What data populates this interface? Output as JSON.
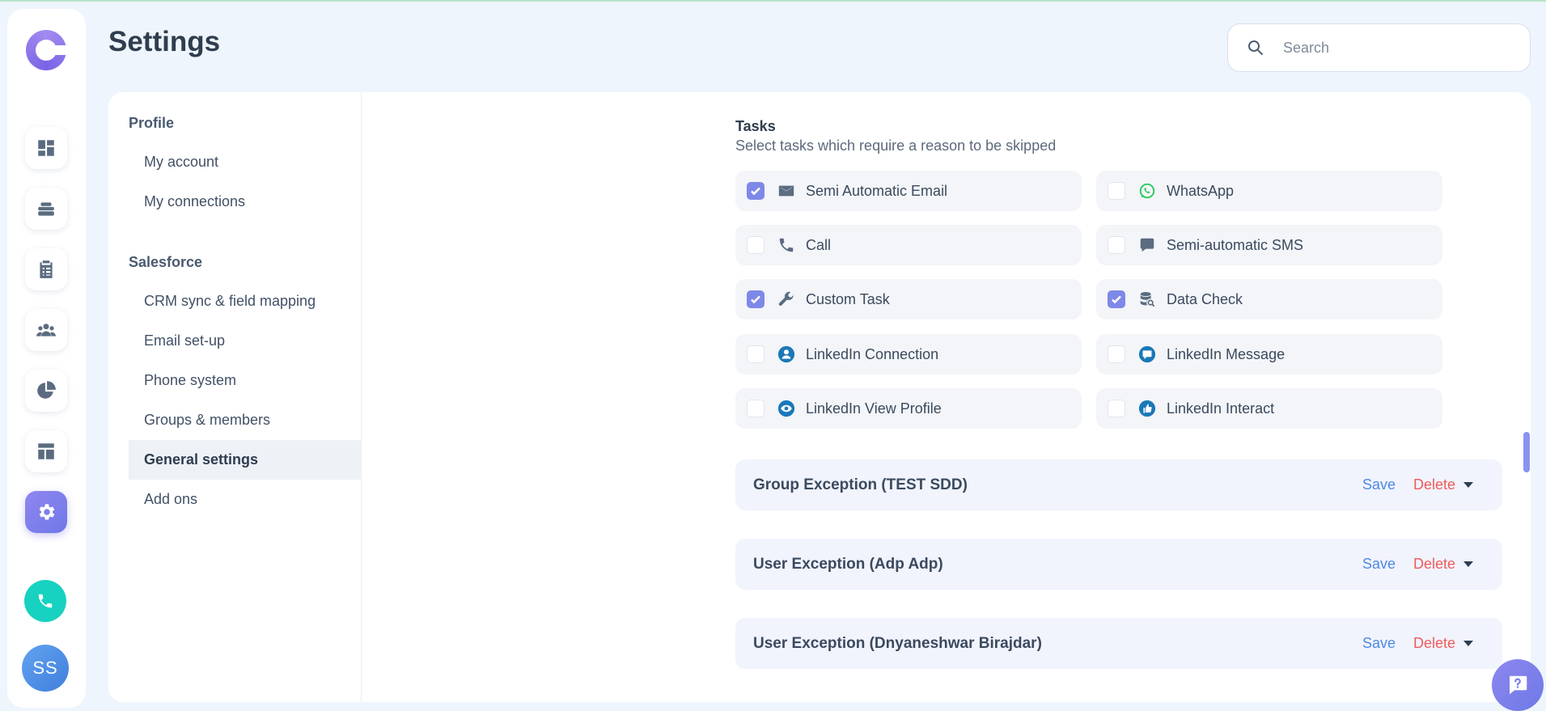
{
  "header": {
    "title": "Settings",
    "search_placeholder": "Search"
  },
  "rail": {
    "items": [
      {
        "name": "dashboard-icon"
      },
      {
        "name": "layers-icon"
      },
      {
        "name": "clipboard-icon"
      },
      {
        "name": "people-icon"
      },
      {
        "name": "pie-chart-icon"
      },
      {
        "name": "layout-icon"
      },
      {
        "name": "gear-icon",
        "active": true
      }
    ],
    "avatar_initials": "SS"
  },
  "subnav": {
    "sections": [
      {
        "title": "Profile",
        "items": [
          "My account",
          "My connections"
        ]
      },
      {
        "title": "Salesforce",
        "items": [
          "CRM sync & field mapping",
          "Email set-up",
          "Phone system",
          "Groups & members",
          "General settings",
          "Add ons"
        ]
      }
    ],
    "active_item": "General settings"
  },
  "tasks": {
    "title": "Tasks",
    "subtitle": "Select tasks which require a reason to be skipped",
    "items": [
      {
        "label": "Semi Automatic Email",
        "checked": true,
        "icon": "email-icon"
      },
      {
        "label": "WhatsApp",
        "checked": false,
        "icon": "whatsapp-icon"
      },
      {
        "label": "Call",
        "checked": false,
        "icon": "phone-icon"
      },
      {
        "label": "Semi-automatic SMS",
        "checked": false,
        "icon": "sms-icon"
      },
      {
        "label": "Custom Task",
        "checked": true,
        "icon": "wrench-icon"
      },
      {
        "label": "Data Check",
        "checked": true,
        "icon": "database-search-icon"
      },
      {
        "label": "LinkedIn Connection",
        "checked": false,
        "icon": "linkedin-user-icon"
      },
      {
        "label": "LinkedIn Message",
        "checked": false,
        "icon": "linkedin-message-icon"
      },
      {
        "label": "LinkedIn View Profile",
        "checked": false,
        "icon": "linkedin-eye-icon"
      },
      {
        "label": "LinkedIn Interact",
        "checked": false,
        "icon": "linkedin-thumbs-up-icon"
      }
    ]
  },
  "exceptions": [
    {
      "title": "Group Exception (TEST SDD)",
      "save_label": "Save",
      "delete_label": "Delete"
    },
    {
      "title": "User Exception (Adp Adp)",
      "save_label": "Save",
      "delete_label": "Delete"
    },
    {
      "title": "User Exception (Dnyaneshwar Birajdar)",
      "save_label": "Save",
      "delete_label": "Delete"
    }
  ],
  "colors": {
    "accent": "#7e88e8",
    "save": "#4d8ae0",
    "delete": "#ef5b5b",
    "linkedin": "#1a78b8",
    "whatsapp": "#25c95a"
  }
}
